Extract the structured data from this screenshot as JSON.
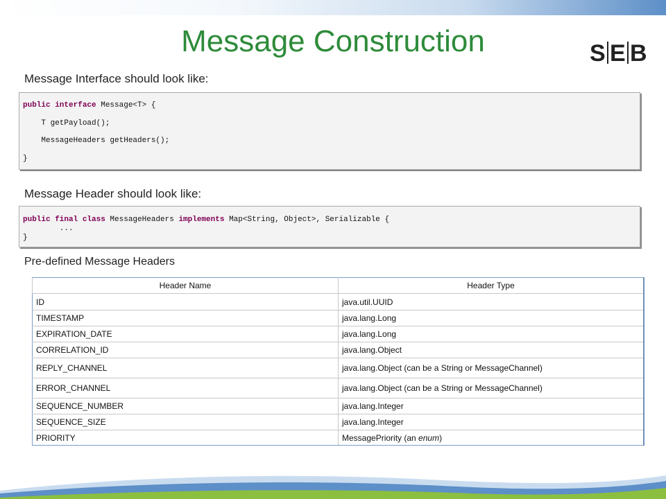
{
  "slide": {
    "title": "Message Construction",
    "logo_text": "SEB"
  },
  "sections": {
    "interface_label": "Message Interface should look like:",
    "header_label": "Message Header should look like:",
    "predefined_label": "Pre-defined Message Headers"
  },
  "interface_code": {
    "line1_kw": "public interface",
    "line1_rest": " Message<T> {",
    "line2": "    T getPayload();",
    "line3": "    MessageHeaders getHeaders();",
    "line4": "}"
  },
  "header_code": {
    "line1_kw1": "public final class",
    "line1_mid": " MessageHeaders ",
    "line1_kw2": "implements",
    "line1_rest": " Map<String, Object>, Serializable {",
    "line2": "        ...",
    "line3": "}"
  },
  "table": {
    "headers": [
      "Header Name",
      "Header Type"
    ],
    "rows": [
      [
        "ID",
        "java.util.UUID"
      ],
      [
        "TIMESTAMP",
        "java.lang.Long"
      ],
      [
        "EXPIRATION_DATE",
        "java.lang.Long"
      ],
      [
        "CORRELATION_ID",
        "java.lang.Object"
      ],
      [
        "REPLY_CHANNEL",
        "java.lang.Object (can be a String or MessageChannel)"
      ],
      [
        "ERROR_CHANNEL",
        "java.lang.Object (can be a String or MessageChannel)"
      ],
      [
        "SEQUENCE_NUMBER",
        "java.lang.Integer"
      ],
      [
        "SEQUENCE_SIZE",
        "java.lang.Integer"
      ],
      [
        "PRIORITY",
        "MessagePriority (an enum)"
      ]
    ],
    "priority_prefix": "MessagePriority (an ",
    "priority_em": "enum",
    "priority_suffix": ")"
  },
  "colors": {
    "title": "#2e8b3a",
    "keyword": "#7f0055",
    "accent_blue": "#5d8fc8",
    "accent_green": "#8cbf3f"
  }
}
